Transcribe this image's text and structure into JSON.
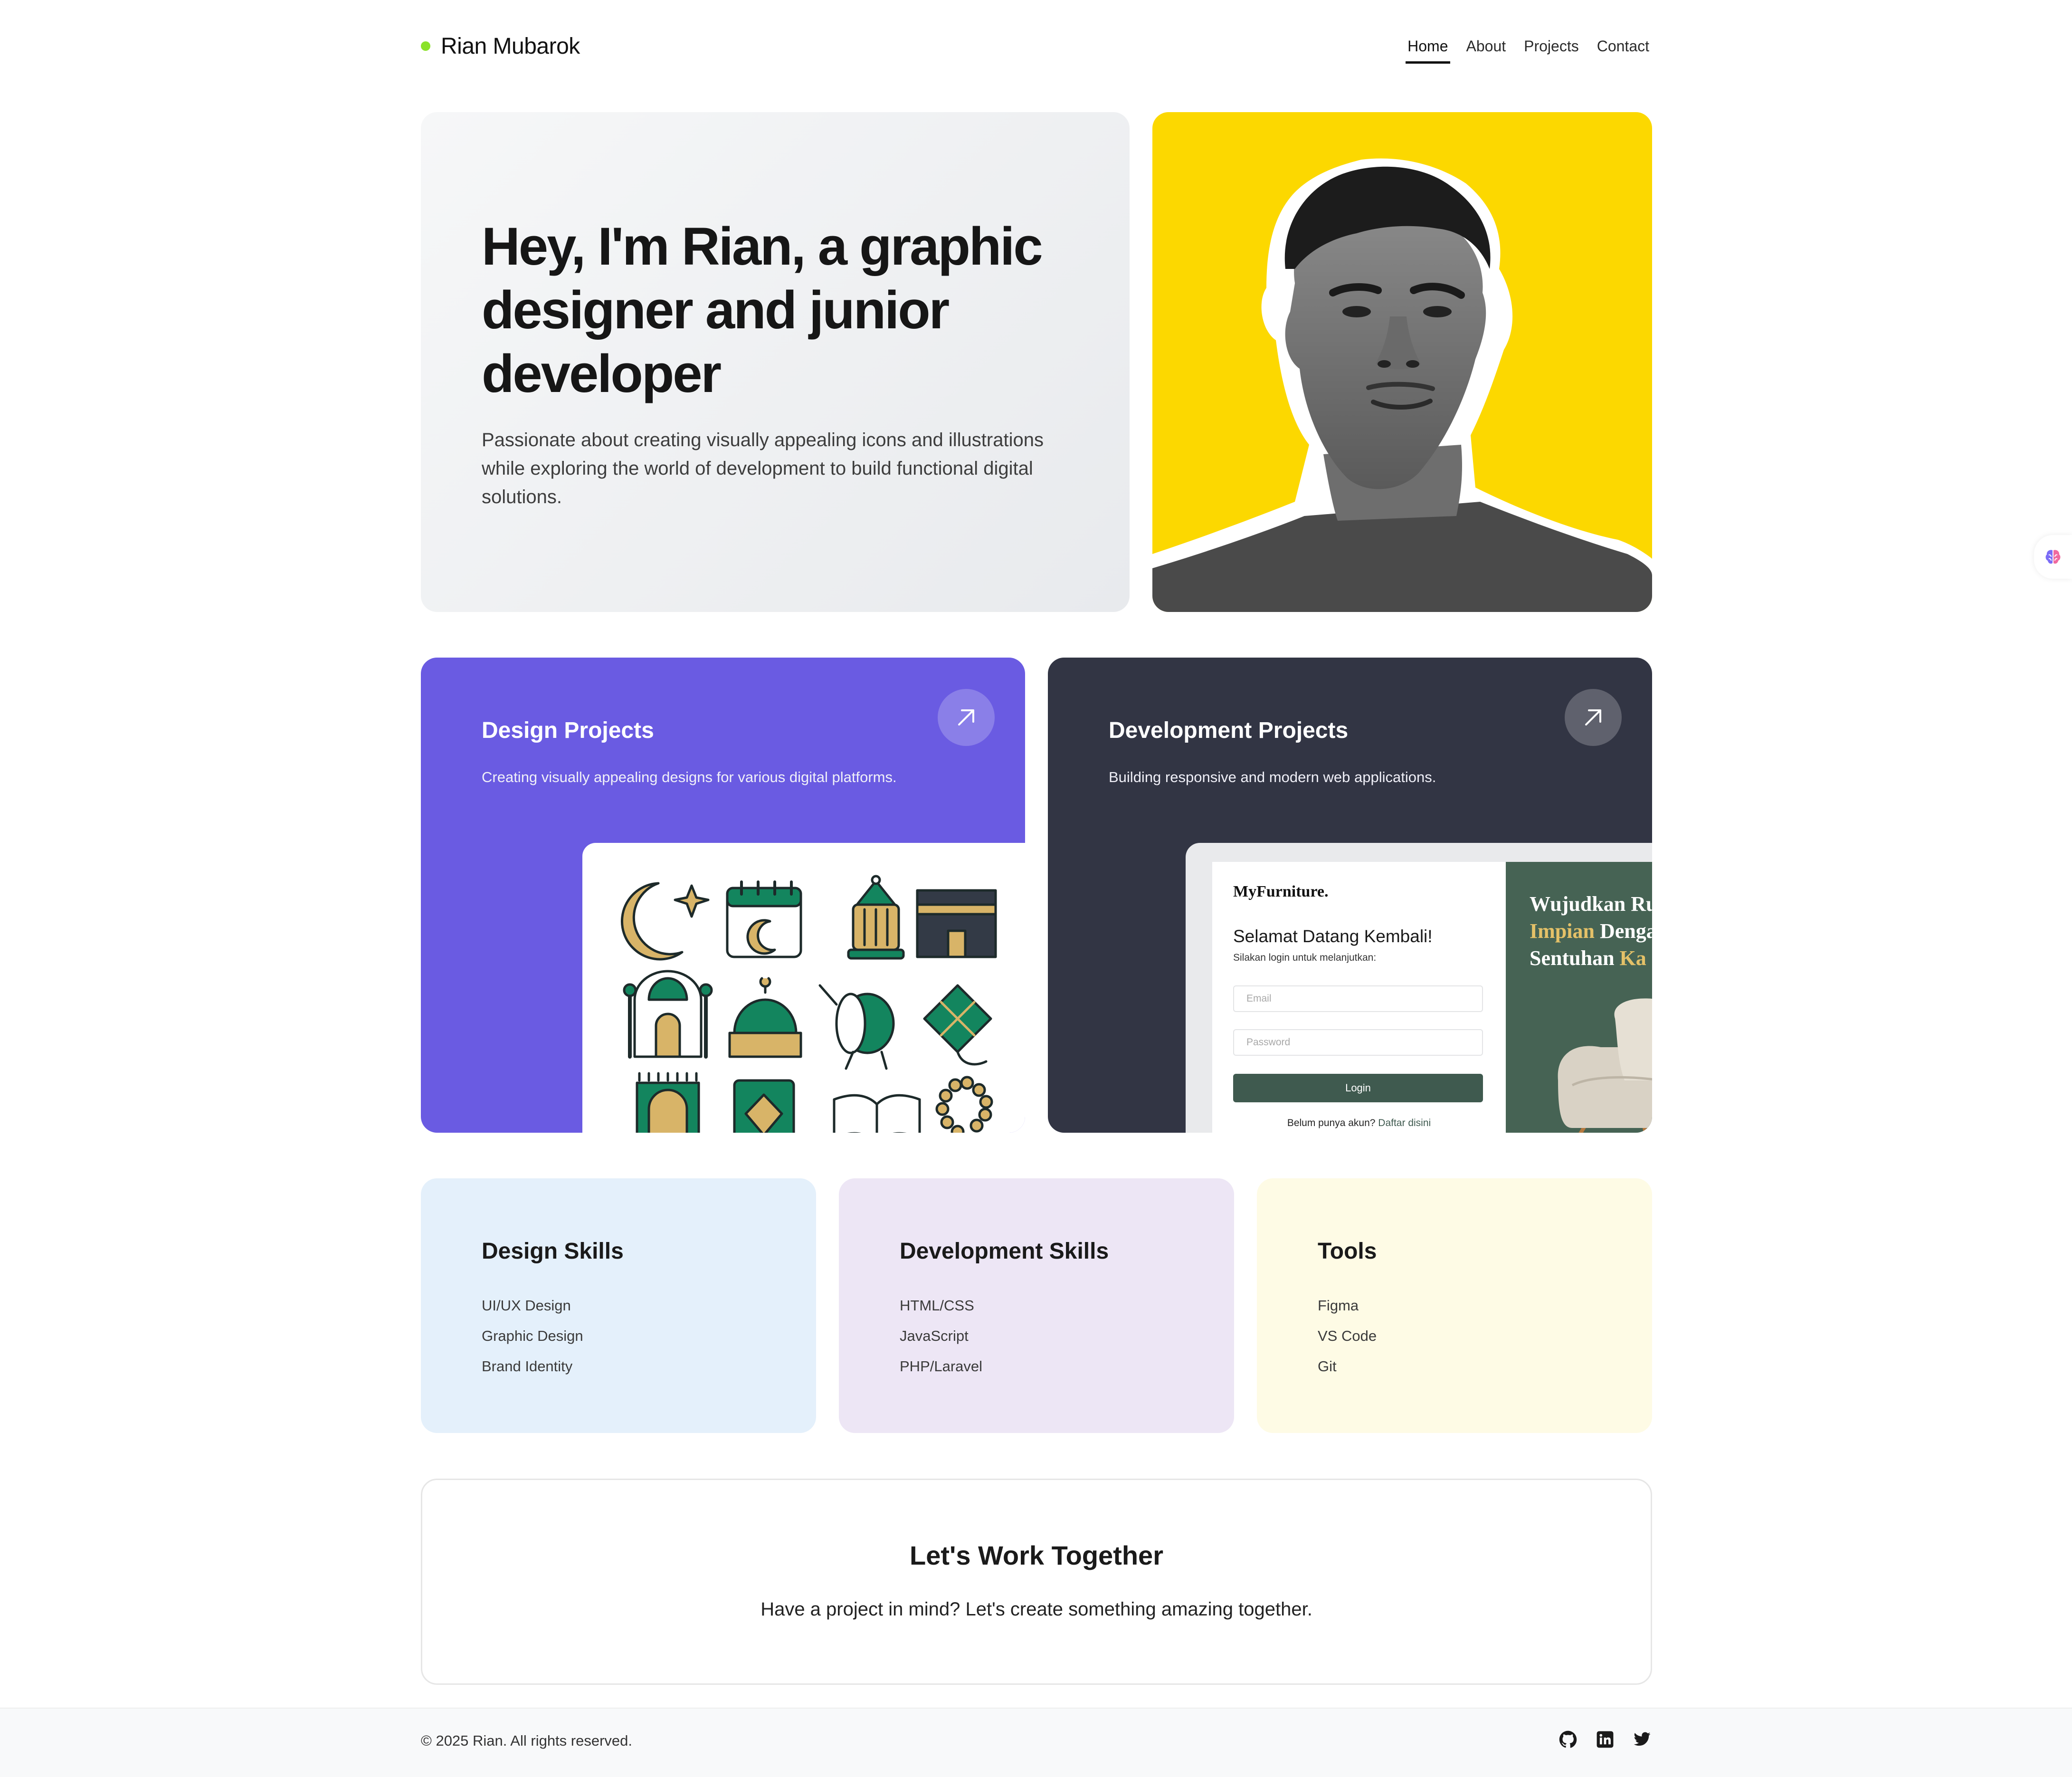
{
  "header": {
    "brand": "Rian Mubarok",
    "brand_dot_color": "#8be22a",
    "nav": [
      {
        "label": "Home",
        "active": true
      },
      {
        "label": "About",
        "active": false
      },
      {
        "label": "Projects",
        "active": false
      },
      {
        "label": "Contact",
        "active": false
      }
    ]
  },
  "hero": {
    "title": "Hey, I'm Rian, a graphic designer and junior developer",
    "subtitle": "Passionate about creating visually appealing icons and illustrations while exploring the world of development to build functional digital solutions.",
    "photo_background": "#fcd800",
    "photo_icon": "portrait-photo"
  },
  "projects": {
    "design": {
      "title": "Design Projects",
      "description": "Creating visually appealing designs for various digital platforms.",
      "color": "#6a5be2",
      "arrow_icon": "arrow-up-right-icon"
    },
    "development": {
      "title": "Development Projects",
      "description": "Building responsive and modern web applications.",
      "color": "#323544",
      "arrow_icon": "arrow-up-right-icon"
    }
  },
  "dev_preview": {
    "logo": "MyFurniture.",
    "welcome": "Selamat Datang Kembali!",
    "welcome_sub": "Silakan login untuk melanjutkan:",
    "email_placeholder": "Email",
    "password_placeholder": "Password",
    "login_label": "Login",
    "register_text": "Belum punya akun?",
    "register_link": "Daftar disini",
    "headline_1": "Wujudkan Ru",
    "headline_2a": "Impian",
    "headline_2b": "Denga",
    "headline_3a": "Sentuhan",
    "headline_3b": "Ka"
  },
  "skills": {
    "design": {
      "title": "Design Skills",
      "items": [
        "UI/UX Design",
        "Graphic Design",
        "Brand Identity"
      ],
      "color": "#e4f0fb"
    },
    "development": {
      "title": "Development Skills",
      "items": [
        "HTML/CSS",
        "JavaScript",
        "PHP/Laravel"
      ],
      "color": "#ede6f5"
    },
    "tools": {
      "title": "Tools",
      "items": [
        "Figma",
        "VS Code",
        "Git"
      ],
      "color": "#fefbe5"
    }
  },
  "cta": {
    "title": "Let's Work Together",
    "subtitle": "Have a project in mind? Let's create something amazing together."
  },
  "footer": {
    "copyright": "© 2025 Rian. All rights reserved.",
    "social_icons": [
      "github-icon",
      "linkedin-icon",
      "twitter-icon"
    ]
  }
}
